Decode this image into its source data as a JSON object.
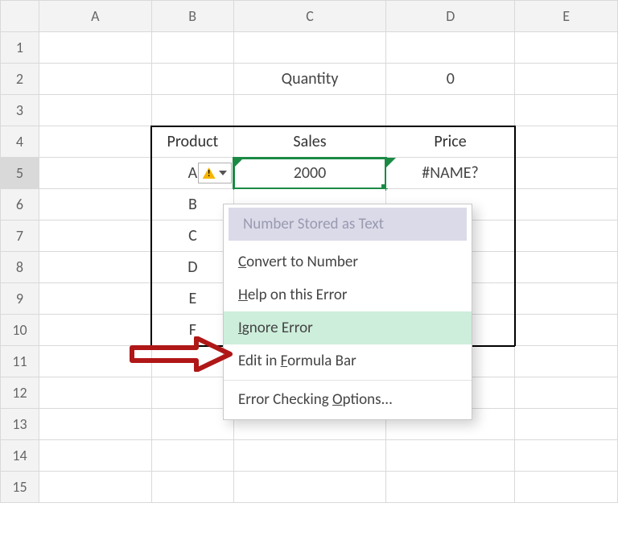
{
  "columns": [
    "A",
    "B",
    "C",
    "D",
    "E"
  ],
  "rows": [
    "1",
    "2",
    "3",
    "4",
    "5",
    "6",
    "7",
    "8",
    "9",
    "10",
    "11",
    "12",
    "13",
    "14",
    "15"
  ],
  "cells": {
    "c2": "Quantity",
    "d2": "0",
    "b4": "Product",
    "c4": "Sales",
    "d4": "Price",
    "b5": "A",
    "c5": "2000",
    "d5": "#NAME?",
    "b6": "B",
    "b7": "C",
    "b8": "D",
    "b9": "E",
    "b10": "F"
  },
  "menu": {
    "title": "Number Stored as Text",
    "items": [
      {
        "pre": "",
        "u": "C",
        "post": "onvert to Number"
      },
      {
        "pre": "",
        "u": "H",
        "post": "elp on this Error"
      },
      {
        "pre": "",
        "u": "I",
        "post": "gnore Error"
      },
      {
        "pre": "Edit in ",
        "u": "F",
        "post": "ormula Bar"
      },
      {
        "pre": "Error Checking ",
        "u": "O",
        "post": "ptions..."
      }
    ]
  }
}
